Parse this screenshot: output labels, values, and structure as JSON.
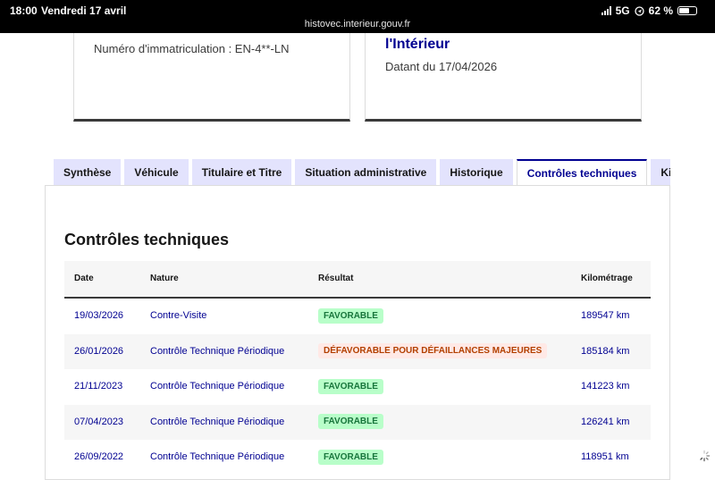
{
  "status_bar": {
    "time": "18:00",
    "date": "Vendredi 17 avril",
    "url": "histovec.interieur.gouv.fr",
    "network": "5G",
    "battery": "62 %",
    "battery_level": 0.62
  },
  "cards": {
    "registration": "Numéro d'immatriculation : EN-4**-LN",
    "source_title": "l'Intérieur",
    "dated": "Datant du 17/04/2026"
  },
  "tabs": [
    {
      "label": "Synthèse"
    },
    {
      "label": "Véhicule"
    },
    {
      "label": "Titulaire et Titre"
    },
    {
      "label": "Situation administrative"
    },
    {
      "label": "Historique"
    },
    {
      "label": "Contrôles techniques",
      "active": true
    },
    {
      "label": "Kilo"
    }
  ],
  "section_title": "Contrôles techniques",
  "table": {
    "headers": {
      "date": "Date",
      "nature": "Nature",
      "result": "Résultat",
      "mileage": "Kilométrage"
    },
    "rows": [
      {
        "date": "19/03/2026",
        "nature": "Contre-Visite",
        "result": "FAVORABLE",
        "mileage": "189547 km"
      },
      {
        "date": "26/01/2026",
        "nature": "Contrôle Technique Périodique",
        "result": "DÉFAVORABLE POUR DÉFAILLANCES MAJEURES",
        "mileage": "185184 km"
      },
      {
        "date": "21/11/2023",
        "nature": "Contrôle Technique Périodique",
        "result": "FAVORABLE",
        "mileage": "141223 km"
      },
      {
        "date": "07/04/2023",
        "nature": "Contrôle Technique Périodique",
        "result": "FAVORABLE",
        "mileage": "126241 km"
      },
      {
        "date": "26/09/2022",
        "nature": "Contrôle Technique Périodique",
        "result": "FAVORABLE",
        "mileage": "118951 km"
      }
    ]
  }
}
